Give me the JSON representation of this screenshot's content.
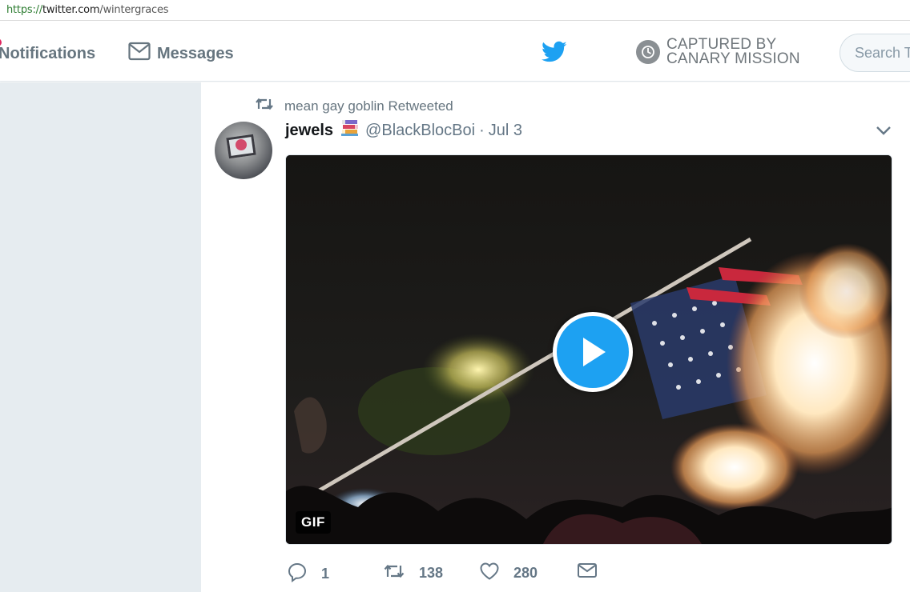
{
  "browser": {
    "url_scheme": "https://",
    "url_host": "twitter.com",
    "url_path": "/wintergraces"
  },
  "nav": {
    "notifications_label": "Notifications",
    "messages_label": "Messages",
    "canary_line1": "CAPTURED BY",
    "canary_line2": "CANARY MISSION",
    "search_placeholder": "Search Twitter",
    "icons": [
      "envelope-icon",
      "twitter-bird-icon",
      "canary-badge-icon"
    ]
  },
  "tweet": {
    "retweeted_by": "mean gay goblin Retweeted",
    "author_name": "jewels",
    "author_emoji": "books-emoji",
    "handle": "@BlackBlocBoi",
    "separator": "·",
    "date": "Jul 3",
    "media_badge": "GIF",
    "replies": "1",
    "retweets": "138",
    "likes": "280"
  },
  "colors": {
    "twitter_blue": "#1da1f2",
    "muted": "#657786",
    "background_gray": "#e6ecf0"
  }
}
